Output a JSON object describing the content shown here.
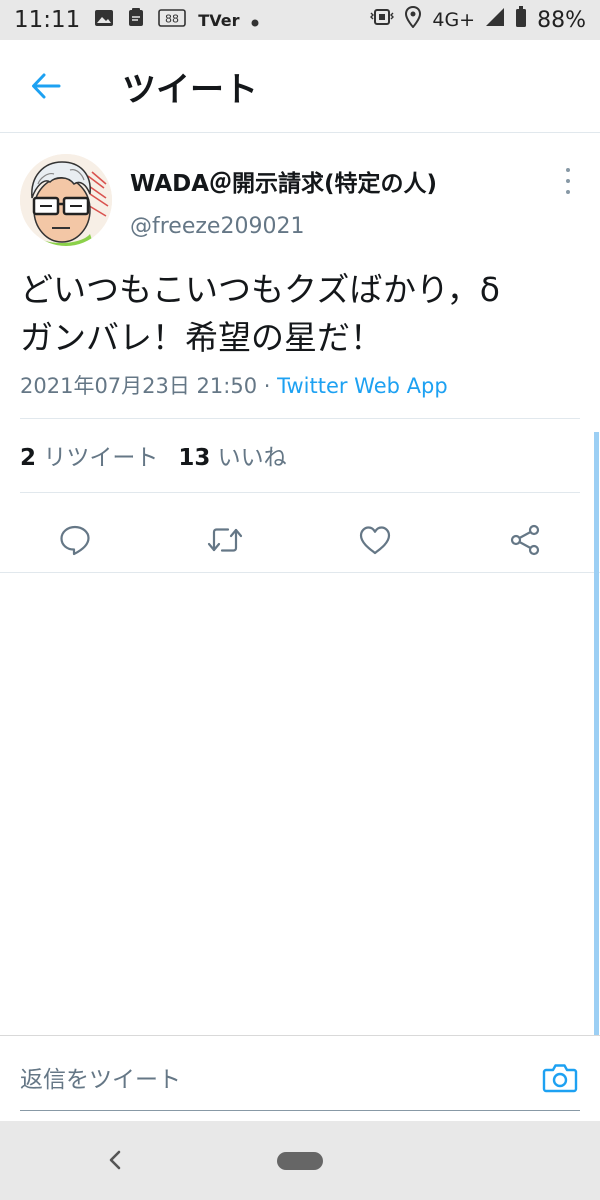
{
  "status_bar": {
    "time": "11:11",
    "tv_label": "TVer",
    "badge_text": "88",
    "network": "4G+",
    "battery": "88%",
    "icons": [
      "image-icon",
      "clipboard-icon",
      "tver-icon",
      "dot-icon",
      "vibrate-icon",
      "location-icon",
      "signal-icon",
      "battery-icon"
    ]
  },
  "header": {
    "title": "ツイート",
    "back_icon": "arrow-left-icon"
  },
  "tweet": {
    "display_name": "WADA＠開示請求(特定の人)",
    "handle": "@freeze209021",
    "text_lines": [
      "どいつもこいつもクズばかり，δ",
      "ガンバレ！希望の星だ！"
    ],
    "timestamp": "2021年07月23日 21:50",
    "separator": " · ",
    "source": "Twitter Web App",
    "retweet_count": "2",
    "retweet_label": "リツイート",
    "like_count": "13",
    "like_label": "いいね",
    "actions": [
      "reply-icon",
      "retweet-icon",
      "like-icon",
      "share-icon"
    ]
  },
  "reply": {
    "placeholder": "返信をツイート",
    "camera_icon": "camera-icon"
  },
  "colors": {
    "accent": "#1da1f2",
    "text": "#14171a",
    "secondary": "#657786"
  }
}
